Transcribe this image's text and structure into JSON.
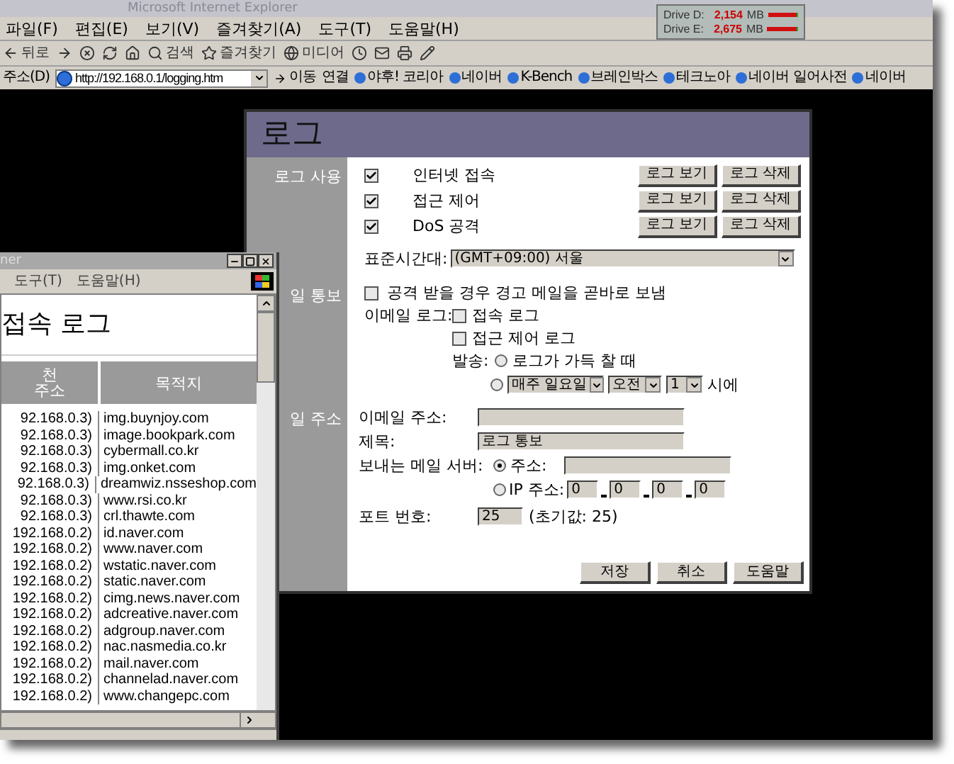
{
  "browser": {
    "title": "Microsoft Internet Explorer",
    "menu": [
      "파일(F)",
      "편집(E)",
      "보기(V)",
      "즐겨찾기(A)",
      "도구(T)",
      "도움말(H)"
    ],
    "toolbar": [
      {
        "kind": "back",
        "label": "뒤로"
      },
      {
        "kind": "forward"
      },
      {
        "kind": "stop"
      },
      {
        "kind": "refresh"
      },
      {
        "kind": "home"
      },
      {
        "kind": "search",
        "label": "검색"
      },
      {
        "kind": "favorites",
        "label": "즐겨찾기"
      },
      {
        "kind": "media",
        "label": "미디어"
      },
      {
        "kind": "history"
      },
      {
        "kind": "mail"
      },
      {
        "kind": "print"
      },
      {
        "kind": "edit"
      }
    ],
    "address": {
      "label": "주소(D)",
      "url": "http://192.168.0.1/logging.htm",
      "go": "이동"
    },
    "links": {
      "label": "연결",
      "items": [
        "야후! 코리아",
        "네이버",
        "K-Bench",
        "브레인박스",
        "테크노아",
        "네이버 일어사전",
        "네이버"
      ]
    }
  },
  "drive_monitor": [
    {
      "name": "Drive D:",
      "value": "2,154",
      "unit": "MB",
      "level": 0.95
    },
    {
      "name": "Drive E:",
      "value": "2,675",
      "unit": "MB",
      "level": 0.95
    }
  ],
  "log_dialog": {
    "title": "로그",
    "sections": [
      "로그 사용",
      "일 통보",
      "일 주소"
    ],
    "log_types": [
      {
        "label": "인터넷 접속",
        "checked": true,
        "view": "로그 보기",
        "delete": "로그 삭제"
      },
      {
        "label": "접근 제어",
        "checked": true,
        "view": "로그 보기",
        "delete": "로그 삭제"
      },
      {
        "label": "DoS 공격",
        "checked": true,
        "view": "로그 보기",
        "delete": "로그 삭제"
      }
    ],
    "timezone": {
      "label": "표준시간대:",
      "value": "(GMT+09:00) 서울"
    },
    "alert_mail": {
      "label": "공격 받을 경우 경고 메일을 곧바로 보냄",
      "checked": false
    },
    "email_log": {
      "label": "이메일 로그:",
      "options": [
        {
          "label": "접속 로그",
          "checked": false
        },
        {
          "label": "접근 제어 로그",
          "checked": false
        }
      ]
    },
    "send": {
      "label": "발송:",
      "full_option": {
        "label": "로그가 가득 찰 때",
        "selected": false
      },
      "schedule_option": {
        "selected": false,
        "day": "매주 일요일",
        "ampm": "오전",
        "hour": "1",
        "suffix": "시에"
      }
    },
    "email_address": {
      "label": "이메일 주소:"
    },
    "subject": {
      "label": "제목:",
      "value": "로그 통보"
    },
    "mail_server": {
      "label": "보내는 메일 서버:",
      "address_option": {
        "label": "주소:",
        "selected": true
      },
      "ip_option": {
        "label": "IP 주소:",
        "selected": false,
        "octets": [
          "0",
          "0",
          "0",
          "0"
        ]
      }
    },
    "port": {
      "label": "포트 번호:",
      "value": "25",
      "note": "(초기값: 25)"
    },
    "buttons": [
      "저장",
      "취소",
      "도움말"
    ]
  },
  "log_window": {
    "title": "ner",
    "menu": [
      "도구(T)",
      "도움말(H)"
    ],
    "heading": "접속 로그",
    "columns": [
      "천\n주소",
      "목적지"
    ],
    "rows": [
      [
        "92.168.0.3)",
        "img.buynjoy.com"
      ],
      [
        "92.168.0.3)",
        "image.bookpark.com"
      ],
      [
        "92.168.0.3)",
        "cybermall.co.kr"
      ],
      [
        "92.168.0.3)",
        "img.onket.com"
      ],
      [
        "92.168.0.3)",
        "dreamwiz.nsseshop.com"
      ],
      [
        "92.168.0.3)",
        "www.rsi.co.kr"
      ],
      [
        "92.168.0.3)",
        "crl.thawte.com"
      ],
      [
        "192.168.0.2)",
        "id.naver.com"
      ],
      [
        "192.168.0.2)",
        "www.naver.com"
      ],
      [
        "192.168.0.2)",
        "wstatic.naver.com"
      ],
      [
        "192.168.0.2)",
        "static.naver.com"
      ],
      [
        "192.168.0.2)",
        "cimg.news.naver.com"
      ],
      [
        "192.168.0.2)",
        "adcreative.naver.com"
      ],
      [
        "192.168.0.2)",
        "adgroup.naver.com"
      ],
      [
        "192.168.0.2)",
        "nac.nasmedia.co.kr"
      ],
      [
        "192.168.0.2)",
        "mail.naver.com"
      ],
      [
        "192.168.0.2)",
        "channelad.naver.com"
      ],
      [
        "192.168.0.2)",
        "www.changepc.com"
      ]
    ]
  }
}
